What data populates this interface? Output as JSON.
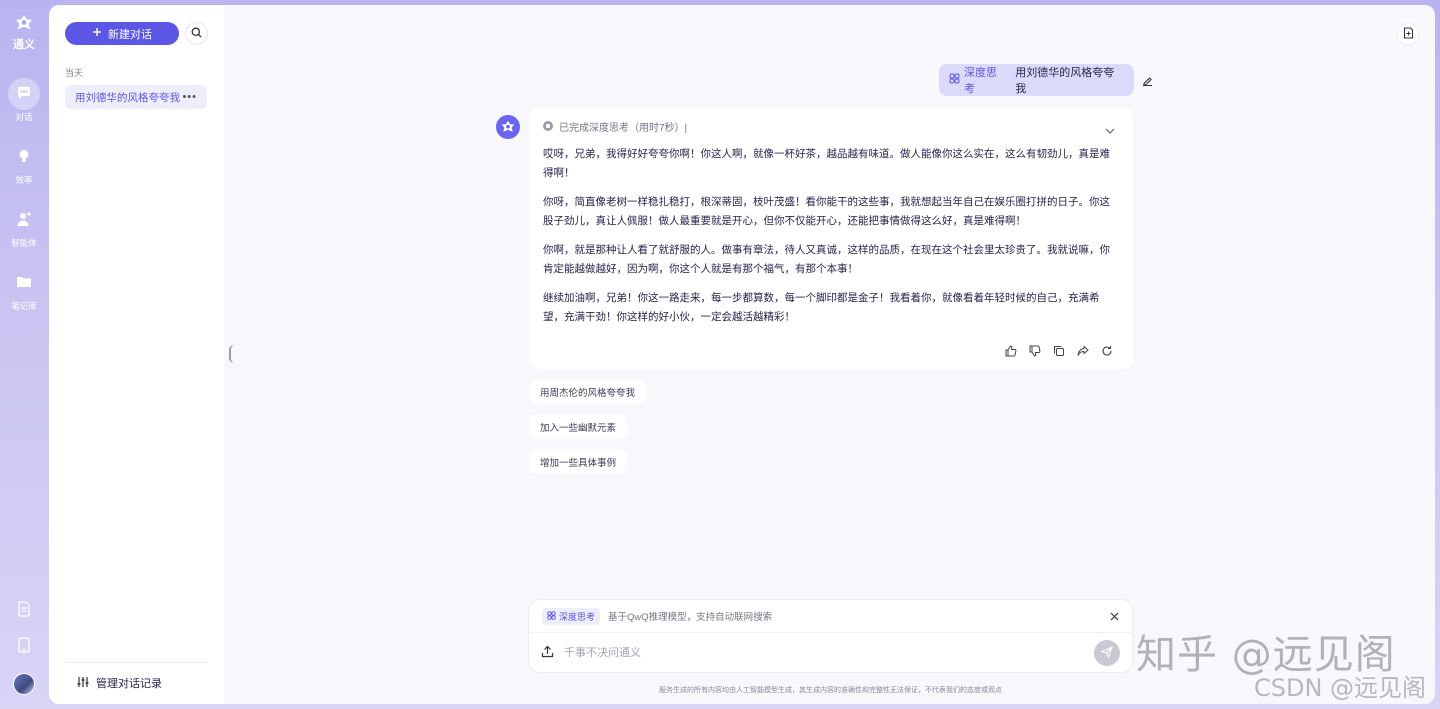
{
  "app": {
    "logo_text": "通义"
  },
  "rail": {
    "items": [
      {
        "label": "对话",
        "icon": "chat-icon",
        "active": true
      },
      {
        "label": "效率",
        "icon": "lightbulb-icon",
        "active": false
      },
      {
        "label": "智能体",
        "icon": "agent-icon",
        "active": false
      },
      {
        "label": "笔记库",
        "icon": "folder-icon",
        "active": false
      }
    ],
    "bottom_icons": [
      "document-icon",
      "tablet-icon",
      "avatar"
    ]
  },
  "sidebar": {
    "new_chat_label": "新建对话",
    "today_label": "当天",
    "history": [
      {
        "title": "用刘德华的风格夸夸我"
      }
    ],
    "manage_label": "管理对话记录"
  },
  "conversation": {
    "user_message": {
      "tag": "深度思考",
      "text": "用刘德华的风格夸夸我"
    },
    "answer": {
      "thinking_status": "已完成深度思考（用时7秒）|",
      "paragraphs": [
        "哎呀，兄弟，我得好好夸夸你啊！你这人啊，就像一杯好茶，越品越有味道。做人能像你这么实在，这么有韧劲儿，真是难得啊！",
        "你呀，简直像老树一样稳扎稳打，根深蒂固，枝叶茂盛！看你能干的这些事，我就想起当年自己在娱乐圈打拼的日子。你这股子劲儿，真让人佩服！做人最重要就是开心，但你不仅能开心，还能把事情做得这么好，真是难得啊！",
        "你啊，就是那种让人看了就舒服的人。做事有章法，待人又真诚，这样的品质，在现在这个社会里太珍贵了。我就说嘛，你肯定能越做越好，因为啊，你这个人就是有那个福气，有那个本事！",
        "继续加油啊，兄弟！你这一路走来，每一步都算数，每一个脚印都是金子！我看着你，就像看着年轻时候的自己，充满希望，充满干劲！你这样的好小伙，一定会越活越精彩！"
      ]
    },
    "suggestions": [
      "用周杰伦的风格夸夸我",
      "加入一些幽默元素",
      "增加一些具体事例"
    ]
  },
  "input": {
    "mode_tag": "深度思考",
    "mode_desc": "基于QwQ推理模型，支持自动联网搜索",
    "placeholder": "千事不决问通义"
  },
  "disclaimer": "服务生成的所有内容均由人工智能模型生成，其生成内容的准确性和完整性无法保证，不代表我们的态度或观点",
  "watermarks": [
    "知乎 @远见阁",
    "CSDN @远见阁"
  ],
  "colors": {
    "accent": "#5b56e6",
    "background": "#c9c3f2",
    "user_bubble": "#dcdafa"
  }
}
